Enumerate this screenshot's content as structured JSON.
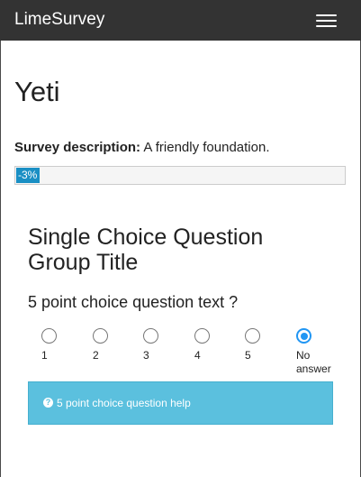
{
  "navbar": {
    "brand": "LimeSurvey",
    "menu_icon": "hamburger-icon"
  },
  "survey": {
    "title": "Yeti",
    "description_label": "Survey description:",
    "description": "A friendly foundation.",
    "progress_text": "-3%"
  },
  "group": {
    "title": "Single Choice Question Group Title"
  },
  "question": {
    "text": "5 point choice question text ?",
    "options": [
      "1",
      "2",
      "3",
      "4",
      "5",
      "No answer"
    ],
    "selected": "No answer",
    "help": "5 point choice question help",
    "help_icon": "question-circle-icon"
  },
  "colors": {
    "navbar": "#333333",
    "accent": "#2196f3",
    "help_bg": "#5bc0de",
    "progress": "#1a8fc4"
  }
}
